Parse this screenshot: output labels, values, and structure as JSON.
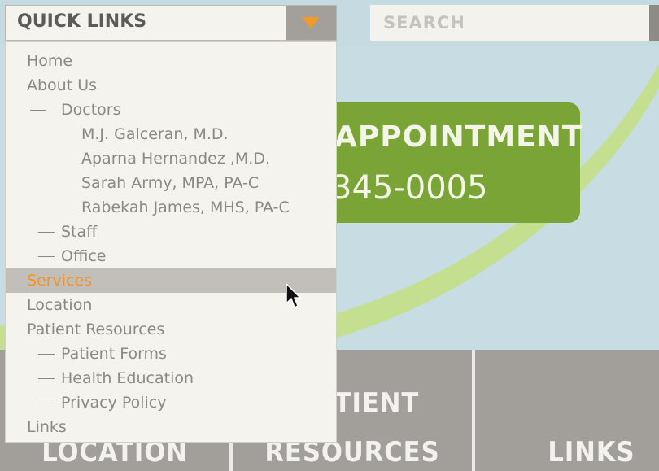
{
  "quick_links": {
    "title": "QUICK LINKS",
    "items": [
      {
        "label": "Home",
        "level": 1
      },
      {
        "label": "About Us",
        "level": 1
      },
      {
        "label": "Doctors",
        "level": 2
      },
      {
        "label": "M.J. Galceran, M.D.",
        "level": 3
      },
      {
        "label": "Aparna Hernandez ,M.D.",
        "level": 3
      },
      {
        "label": "Sarah Army, MPA, PA-C",
        "level": 3
      },
      {
        "label": "Rabekah James, MHS, PA-C",
        "level": 3
      },
      {
        "label": "Staff",
        "level": 2
      },
      {
        "label": "Office",
        "level": 2
      },
      {
        "label": "Services",
        "level": 1,
        "highlighted": true
      },
      {
        "label": "Location",
        "level": 1
      },
      {
        "label": "Patient Resources",
        "level": 1
      },
      {
        "label": "Patient Forms",
        "level": 2
      },
      {
        "label": "Health Education",
        "level": 2
      },
      {
        "label": "Privacy Policy",
        "level": 2
      },
      {
        "label": "Links",
        "level": 1
      }
    ]
  },
  "search": {
    "placeholder": "SEARCH"
  },
  "appointment": {
    "title": "APPOINTMENT",
    "phone": "345-0005"
  },
  "bottom_nav": {
    "location": {
      "line2": "LOCATION"
    },
    "patient_resources": {
      "line1": "TIENT",
      "line2": "RESOURCES"
    },
    "links": {
      "line2": "LINKS"
    }
  },
  "colors": {
    "accent": "#f29a26",
    "green": "#7aa436",
    "gray": "#a29f9b",
    "highlight": "#c2bfbb"
  },
  "icons": {
    "dropdown_toggle": "caret-down-icon",
    "cursor": "mouse-pointer-icon"
  }
}
